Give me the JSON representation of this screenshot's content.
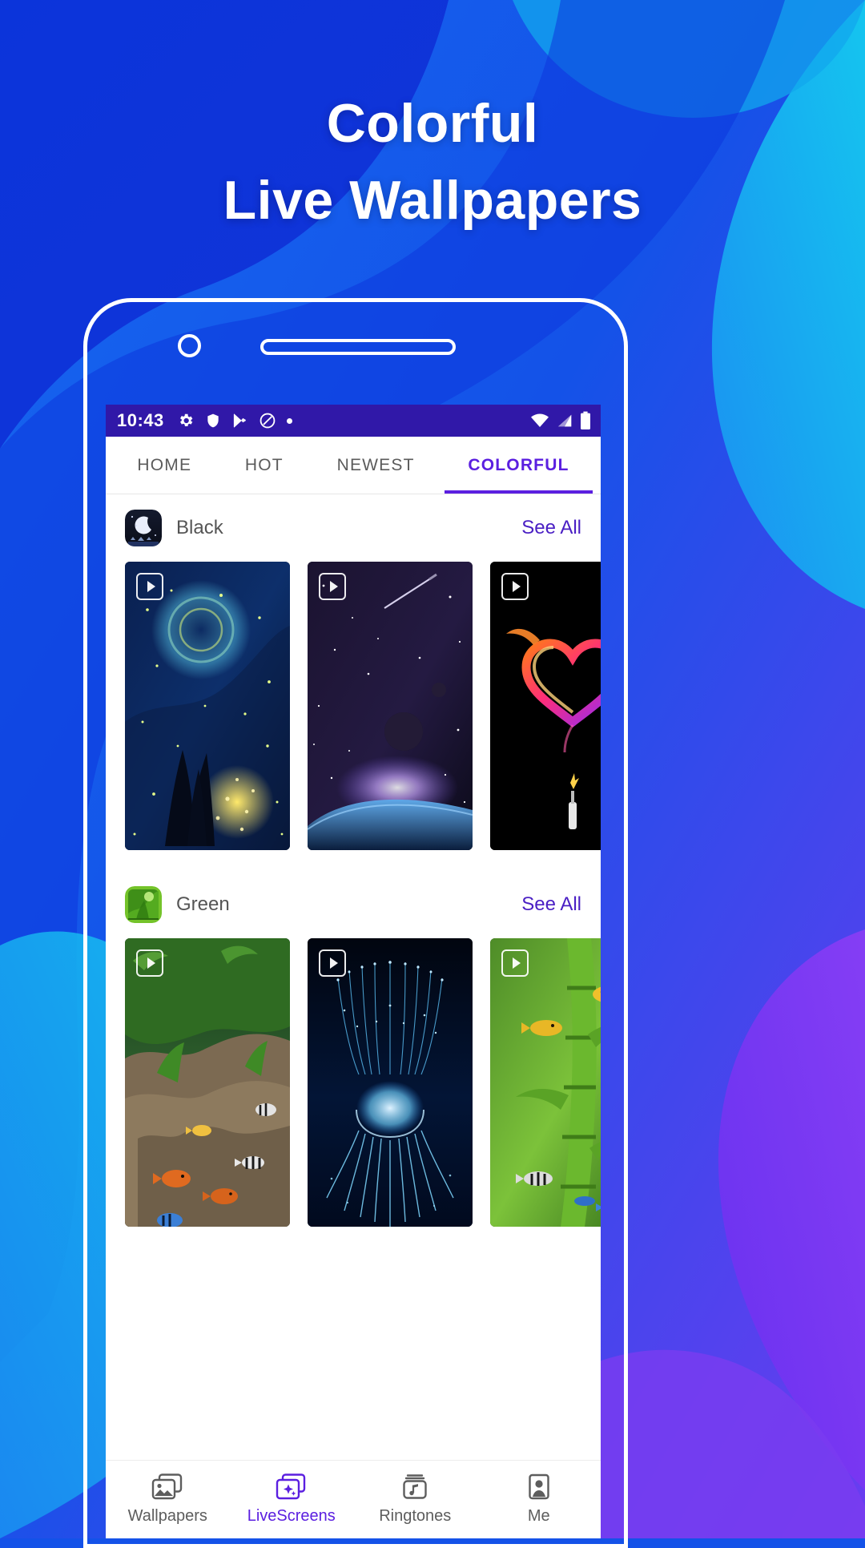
{
  "promo": {
    "line1": "Colorful",
    "line2": "Live Wallpapers",
    "bg_colors": [
      "#0b3fe0",
      "#1452e8",
      "#12c4e8",
      "#1aa9f0",
      "#5a3de8",
      "#7b3cf0"
    ],
    "text_color": "#ffffff"
  },
  "phone": {
    "frame_color": "#ffffff",
    "notch_dot": "camera-dot",
    "notch_bar": "speaker-bar"
  },
  "statusbar": {
    "time": "10:43",
    "bg": "#3018a8",
    "left_icons": [
      "gear-icon",
      "shield-icon",
      "play-store-icon",
      "do-not-disturb-icon",
      "dot-icon"
    ],
    "right_icons": [
      "wifi-icon",
      "signal-icon",
      "battery-icon"
    ]
  },
  "tabs": [
    {
      "label": "HOME",
      "active": false
    },
    {
      "label": "HOT",
      "active": false
    },
    {
      "label": "NEWEST",
      "active": false
    },
    {
      "label": "COLORFUL",
      "active": true
    }
  ],
  "accent_color": "#5b1fe0",
  "sections": [
    {
      "name": "Black",
      "icon": "moon-night-icon",
      "see_all": "See All",
      "cards": [
        {
          "name": "starry-night-tree-wallpaper",
          "badge": "play-icon"
        },
        {
          "name": "space-planet-nebula-wallpaper",
          "badge": "play-icon"
        },
        {
          "name": "fire-heart-wallpaper",
          "badge": "play-icon"
        }
      ]
    },
    {
      "name": "Green",
      "icon": "green-forest-icon",
      "see_all": "See All",
      "cards": [
        {
          "name": "aquarium-fish-rocks-wallpaper",
          "badge": "play-icon"
        },
        {
          "name": "blue-jellyfish-wallpaper",
          "badge": "play-icon"
        },
        {
          "name": "green-bamboo-fish-wallpaper",
          "badge": "play-icon"
        }
      ]
    }
  ],
  "bottom_nav": [
    {
      "label": "Wallpapers",
      "icon": "photos-stack-icon",
      "active": false
    },
    {
      "label": "LiveScreens",
      "icon": "live-sparkle-icon",
      "active": true
    },
    {
      "label": "Ringtones",
      "icon": "music-box-icon",
      "active": false
    },
    {
      "label": "Me",
      "icon": "person-avatar-icon",
      "active": false
    }
  ]
}
